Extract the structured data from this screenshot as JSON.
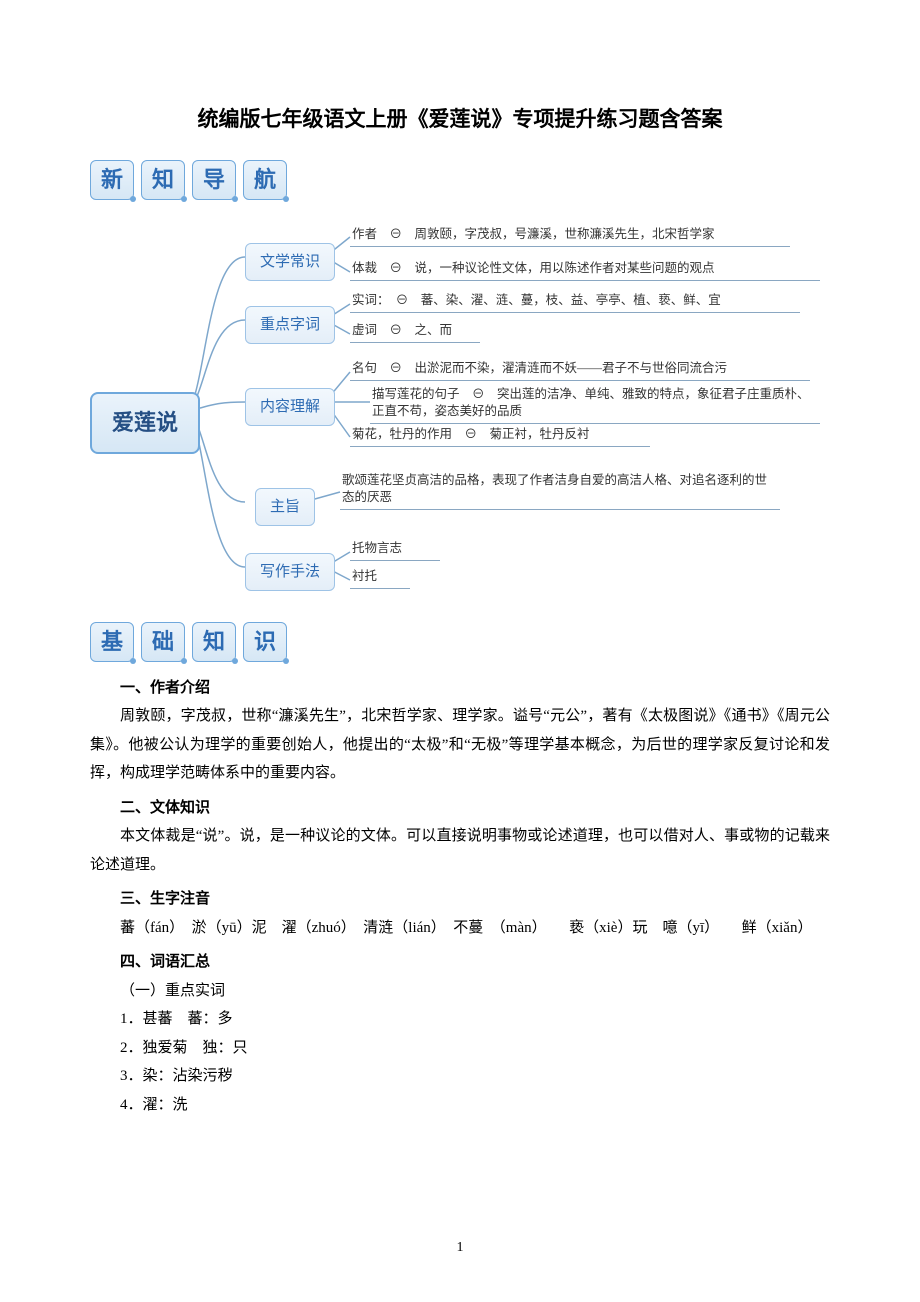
{
  "title": "统编版七年级语文上册《爱莲说》专项提升练习题含答案",
  "tags1": [
    "新",
    "知",
    "导",
    "航"
  ],
  "tags2": [
    "基",
    "础",
    "知",
    "识"
  ],
  "mindmap": {
    "root": "爱莲说",
    "branches": [
      {
        "label": "文学常识",
        "lines": [
          "作者　⊖　周敦颐，字茂叔，号濂溪，世称濂溪先生，北宋哲学家",
          "体裁　⊖　说，一种议论性文体，用以陈述作者对某些问题的观点"
        ]
      },
      {
        "label": "重点字词",
        "lines": [
          "实词：　⊖　蕃、染、濯、涟、蔓，枝、益、亭亭、植、亵、鲜、宜",
          "虚词　⊖　之、而"
        ]
      },
      {
        "label": "内容理解",
        "lines": [
          "名句　⊖　出淤泥而不染，濯清涟而不妖——君子不与世俗同流合污",
          "描写莲花的句子　⊖　突出莲的洁净、单纯、雅致的特点，象征君子庄重质朴、正直不苟，姿态美好的品质",
          "菊花，牡丹的作用　⊖　菊正衬，牡丹反衬"
        ]
      },
      {
        "label": "主旨",
        "lines": [
          "歌颂莲花坚贞高洁的品格，表现了作者洁身自爱的高洁人格、对追名逐利的世态的厌恶"
        ]
      },
      {
        "label": "写作手法",
        "lines": [
          "托物言志",
          "衬托"
        ]
      }
    ]
  },
  "sections": {
    "author_h": "一、作者介绍",
    "author_p": "周敦颐，字茂叔，世称“濂溪先生”，北宋哲学家、理学家。谥号“元公”，著有《太极图说》《通书》《周元公集》。他被公认为理学的重要创始人，他提出的“太极”和“无极”等理学基本概念，为后世的理学家反复讨论和发挥，构成理学范畴体系中的重要内容。",
    "style_h": "二、文体知识",
    "style_p": "本文体裁是“说”。说，是一种议论的文体。可以直接说明事物或论述道理，也可以借对人、事或物的记载来论述道理。",
    "pinyin_h": "三、生字注音",
    "pinyin_p": "蕃（fán）　淤（yū）泥　濯（zhuó）　清涟（lián）　不蔓　（màn）　　亵（xiè）玩　噫（yī）　　鲜（xiǎn）",
    "vocab_h": "四、词语汇总",
    "vocab_sub": "（一）重点实词",
    "vocab_items": [
      "1．甚蕃　蕃：多",
      "2．独爱菊　独：只",
      "3．染：沾染污秽",
      "4．濯：洗"
    ]
  },
  "page_number": "1"
}
